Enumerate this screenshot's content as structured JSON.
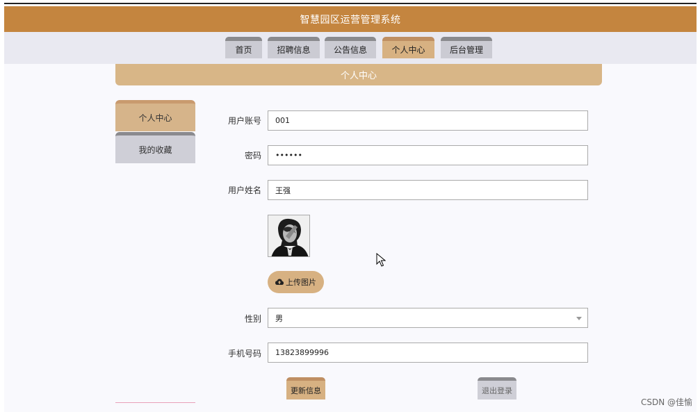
{
  "app": {
    "title": "智慧园区运营管理系统"
  },
  "nav": {
    "tabs": [
      {
        "label": "首页"
      },
      {
        "label": "招聘信息"
      },
      {
        "label": "公告信息"
      },
      {
        "label": "个人中心"
      },
      {
        "label": "后台管理"
      }
    ],
    "active": "个人中心"
  },
  "section": {
    "title": "个人中心"
  },
  "sidebar": {
    "items": [
      {
        "label": "个人中心"
      },
      {
        "label": "我的收藏"
      }
    ]
  },
  "form": {
    "account": {
      "label": "用户账号",
      "value": "001"
    },
    "password": {
      "label": "密码",
      "value": "••••••"
    },
    "name": {
      "label": "用户姓名",
      "value": "王强"
    },
    "upload": {
      "label": "上传图片"
    },
    "gender": {
      "label": "性别",
      "value": "男"
    },
    "phone": {
      "label": "手机号码",
      "value": "13823899996"
    }
  },
  "actions": {
    "update": "更新信息",
    "logout": "退出登录"
  },
  "watermark": "CSDN @佳愉",
  "colors": {
    "primary": "#c4853f",
    "accent": "#d7b182",
    "nav_bg": "#e9e9f1"
  }
}
